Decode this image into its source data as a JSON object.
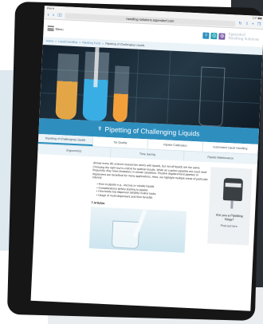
{
  "browser": {
    "status_left": "iPad ⊛",
    "status_right": "1:57 ▮▮▮",
    "back_icon": "‹",
    "forward_icon": "›",
    "bookmarks_icon": "▯▯",
    "url": "handling-solutions.eppendorf.com",
    "reload_icon": "↻",
    "share_icon": "⇧",
    "add_icon": "+",
    "tabs_icon": "❐"
  },
  "header": {
    "menu_label": "Menu",
    "logo_line1": "Eppendorf",
    "logo_line2": "Handling Solutions",
    "colors": {
      "blue": "#2e8fbf",
      "teal": "#26a3b4",
      "purple": "#7b5ba6"
    }
  },
  "breadcrumb": {
    "items": [
      "Home",
      "Liquid Handling",
      "Pipetting Facts"
    ],
    "current": "Pipetting of Challenging Liquids"
  },
  "hero": {
    "title": "Pipetting of Challenging Liquids",
    "icon": "pipette-icon"
  },
  "tabs_row1": [
    "Pipetting of Challenging Liquids",
    "Tip Quality",
    "Pipette Calibration",
    "Automated Liquid Handling"
  ],
  "tabs_row2": [
    "Ergonomics",
    "Time Saving",
    "Pipette Maintenance"
  ],
  "article": {
    "intro": "Almost every life science researcher works with liquids, but not all liquids are the same. Choosing the right tool is critical for optimal results. While air cushion pipettes are used most frequently, they have limitations in certain situations. Positive displacement pipettes or dispensers are beneficial for many applications. Here, we highlight multiple areas of particular interest:",
    "bullets": [
      "How to pipette e.g., viscous or volatile liquids",
      "Considerations before starting to pipette",
      "How bottle-top dispenser simplify routine tasks",
      "Usage of multi-dispensers and their benefits"
    ],
    "articles_label": "7 Articles"
  },
  "sidebar": {
    "question": "Are you a Pipetting Ninja?",
    "link": "Find out here"
  }
}
